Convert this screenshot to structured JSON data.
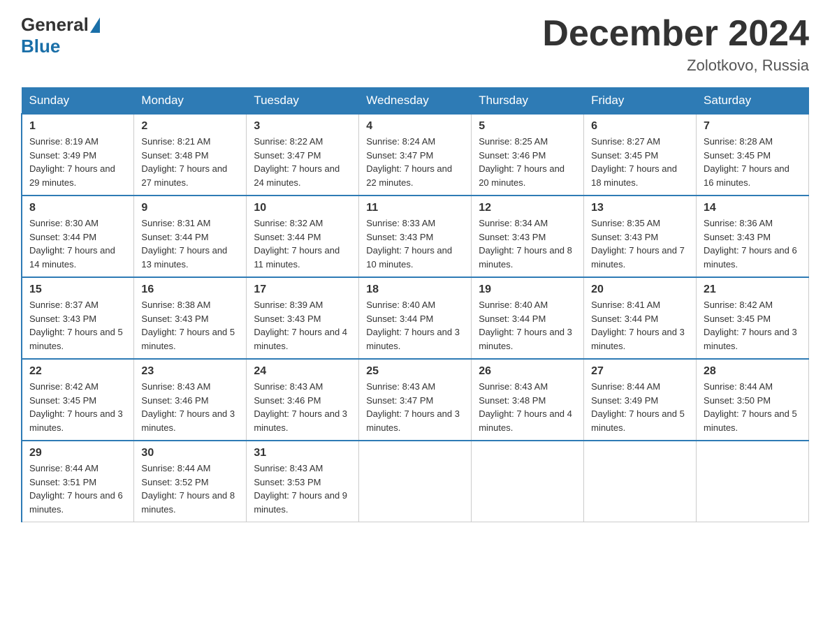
{
  "header": {
    "logo_general": "General",
    "logo_blue": "Blue",
    "month_title": "December 2024",
    "location": "Zolotkovo, Russia"
  },
  "days_of_week": [
    "Sunday",
    "Monday",
    "Tuesday",
    "Wednesday",
    "Thursday",
    "Friday",
    "Saturday"
  ],
  "weeks": [
    [
      {
        "day": "1",
        "sunrise": "8:19 AM",
        "sunset": "3:49 PM",
        "daylight": "7 hours and 29 minutes."
      },
      {
        "day": "2",
        "sunrise": "8:21 AM",
        "sunset": "3:48 PM",
        "daylight": "7 hours and 27 minutes."
      },
      {
        "day": "3",
        "sunrise": "8:22 AM",
        "sunset": "3:47 PM",
        "daylight": "7 hours and 24 minutes."
      },
      {
        "day": "4",
        "sunrise": "8:24 AM",
        "sunset": "3:47 PM",
        "daylight": "7 hours and 22 minutes."
      },
      {
        "day": "5",
        "sunrise": "8:25 AM",
        "sunset": "3:46 PM",
        "daylight": "7 hours and 20 minutes."
      },
      {
        "day": "6",
        "sunrise": "8:27 AM",
        "sunset": "3:45 PM",
        "daylight": "7 hours and 18 minutes."
      },
      {
        "day": "7",
        "sunrise": "8:28 AM",
        "sunset": "3:45 PM",
        "daylight": "7 hours and 16 minutes."
      }
    ],
    [
      {
        "day": "8",
        "sunrise": "8:30 AM",
        "sunset": "3:44 PM",
        "daylight": "7 hours and 14 minutes."
      },
      {
        "day": "9",
        "sunrise": "8:31 AM",
        "sunset": "3:44 PM",
        "daylight": "7 hours and 13 minutes."
      },
      {
        "day": "10",
        "sunrise": "8:32 AM",
        "sunset": "3:44 PM",
        "daylight": "7 hours and 11 minutes."
      },
      {
        "day": "11",
        "sunrise": "8:33 AM",
        "sunset": "3:43 PM",
        "daylight": "7 hours and 10 minutes."
      },
      {
        "day": "12",
        "sunrise": "8:34 AM",
        "sunset": "3:43 PM",
        "daylight": "7 hours and 8 minutes."
      },
      {
        "day": "13",
        "sunrise": "8:35 AM",
        "sunset": "3:43 PM",
        "daylight": "7 hours and 7 minutes."
      },
      {
        "day": "14",
        "sunrise": "8:36 AM",
        "sunset": "3:43 PM",
        "daylight": "7 hours and 6 minutes."
      }
    ],
    [
      {
        "day": "15",
        "sunrise": "8:37 AM",
        "sunset": "3:43 PM",
        "daylight": "7 hours and 5 minutes."
      },
      {
        "day": "16",
        "sunrise": "8:38 AM",
        "sunset": "3:43 PM",
        "daylight": "7 hours and 5 minutes."
      },
      {
        "day": "17",
        "sunrise": "8:39 AM",
        "sunset": "3:43 PM",
        "daylight": "7 hours and 4 minutes."
      },
      {
        "day": "18",
        "sunrise": "8:40 AM",
        "sunset": "3:44 PM",
        "daylight": "7 hours and 3 minutes."
      },
      {
        "day": "19",
        "sunrise": "8:40 AM",
        "sunset": "3:44 PM",
        "daylight": "7 hours and 3 minutes."
      },
      {
        "day": "20",
        "sunrise": "8:41 AM",
        "sunset": "3:44 PM",
        "daylight": "7 hours and 3 minutes."
      },
      {
        "day": "21",
        "sunrise": "8:42 AM",
        "sunset": "3:45 PM",
        "daylight": "7 hours and 3 minutes."
      }
    ],
    [
      {
        "day": "22",
        "sunrise": "8:42 AM",
        "sunset": "3:45 PM",
        "daylight": "7 hours and 3 minutes."
      },
      {
        "day": "23",
        "sunrise": "8:43 AM",
        "sunset": "3:46 PM",
        "daylight": "7 hours and 3 minutes."
      },
      {
        "day": "24",
        "sunrise": "8:43 AM",
        "sunset": "3:46 PM",
        "daylight": "7 hours and 3 minutes."
      },
      {
        "day": "25",
        "sunrise": "8:43 AM",
        "sunset": "3:47 PM",
        "daylight": "7 hours and 3 minutes."
      },
      {
        "day": "26",
        "sunrise": "8:43 AM",
        "sunset": "3:48 PM",
        "daylight": "7 hours and 4 minutes."
      },
      {
        "day": "27",
        "sunrise": "8:44 AM",
        "sunset": "3:49 PM",
        "daylight": "7 hours and 5 minutes."
      },
      {
        "day": "28",
        "sunrise": "8:44 AM",
        "sunset": "3:50 PM",
        "daylight": "7 hours and 5 minutes."
      }
    ],
    [
      {
        "day": "29",
        "sunrise": "8:44 AM",
        "sunset": "3:51 PM",
        "daylight": "7 hours and 6 minutes."
      },
      {
        "day": "30",
        "sunrise": "8:44 AM",
        "sunset": "3:52 PM",
        "daylight": "7 hours and 8 minutes."
      },
      {
        "day": "31",
        "sunrise": "8:43 AM",
        "sunset": "3:53 PM",
        "daylight": "7 hours and 9 minutes."
      },
      null,
      null,
      null,
      null
    ]
  ]
}
